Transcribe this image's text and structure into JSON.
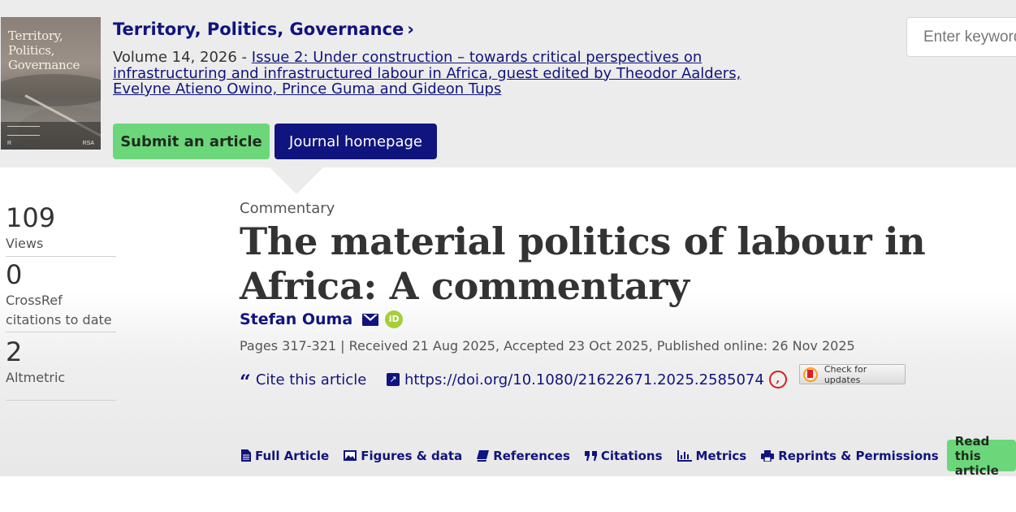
{
  "banner": {
    "cover_title": "Territory, Politics, Governance",
    "cover_alt": "Journal cover",
    "journal_title": "Territory, Politics, Governance",
    "volume_prefix": "Volume 14, 2026 - ",
    "issue_link": "Issue 2: Under construction – towards critical perspectives on infrastructuring and infrastructured labour in Africa, guest edited by Theodor Aalders, Evelyne Atieno Owino, Prince Guma and Gideon Tups",
    "submit_label": "Submit an article",
    "homepage_label": "Journal homepage"
  },
  "search": {
    "placeholder": "Enter keywords, authors, DOI, ORCID etc"
  },
  "metrics": [
    {
      "value": "109",
      "label": "Views"
    },
    {
      "value": "0",
      "label": "CrossRef citations to date"
    },
    {
      "value": "2",
      "label": "Altmetric"
    }
  ],
  "article": {
    "type": "Commentary",
    "title": "The material politics of labour in Africa: A commentary",
    "author": "Stefan Ouma",
    "orcid_text": "iD",
    "dates": "Pages 317-321 | Received 21 Aug 2025, Accepted 23 Oct 2025, Published online: 26 Nov 2025",
    "cite_label": "Cite this article",
    "doi": "https://doi.org/10.1080/21622671.2025.2585074",
    "check_updates": "Check for updates"
  },
  "tabs": [
    {
      "label": "Full Article",
      "icon": "document-icon"
    },
    {
      "label": "Figures & data",
      "icon": "image-icon"
    },
    {
      "label": "References",
      "icon": "book-icon"
    },
    {
      "label": "Citations",
      "icon": "quote-icon"
    },
    {
      "label": "Metrics",
      "icon": "bar-chart-icon"
    },
    {
      "label": "Reprints & Permissions",
      "icon": "print-icon"
    }
  ],
  "read_button": "Read this article",
  "colors": {
    "brand_navy": "#10147e",
    "accent_green": "#6cd77a",
    "banner_gray": "#ececec"
  }
}
